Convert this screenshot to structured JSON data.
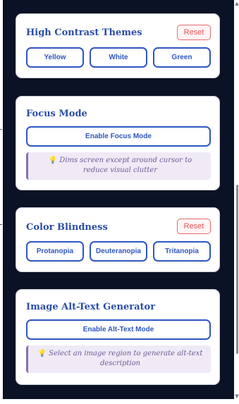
{
  "high_contrast": {
    "title": "High Contrast Themes",
    "reset_label": "Reset",
    "options": [
      "Yellow",
      "White",
      "Green"
    ]
  },
  "focus_mode": {
    "title": "Focus Mode",
    "button_label": "Enable Focus Mode",
    "hint_icon": "lightbulb-icon",
    "hint_text": "Dims screen except around cursor to reduce visual clutter"
  },
  "color_blindness": {
    "title": "Color Blindness",
    "reset_label": "Reset",
    "options": [
      "Protanopia",
      "Deuteranopia",
      "Tritanopia"
    ]
  },
  "alt_text": {
    "title": "Image Alt-Text Generator",
    "button_label": "Enable Alt-Text Mode",
    "hint_icon": "lightbulb-icon",
    "hint_text": "Select an image region to generate alt-text description"
  },
  "colors": {
    "panel_background": "#0c1225",
    "accent_blue": "#2f56c2",
    "title_blue": "#2b4ea5",
    "reset_red": "#e25555",
    "hint_background": "#efeaf6",
    "hint_text": "#6e5a96"
  }
}
